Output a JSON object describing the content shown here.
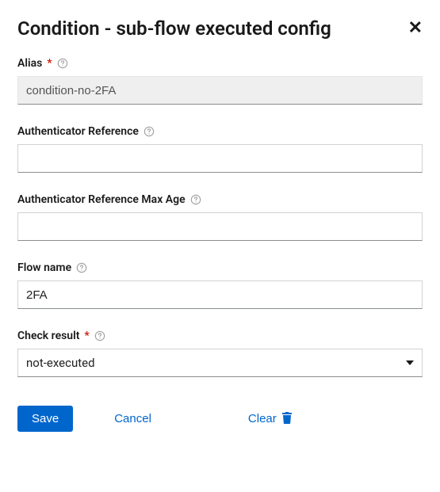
{
  "dialog": {
    "title": "Condition - sub-flow executed config"
  },
  "fields": {
    "alias": {
      "label": "Alias",
      "required": true,
      "value": "condition-no-2FA"
    },
    "authRef": {
      "label": "Authenticator Reference",
      "required": false,
      "value": ""
    },
    "authRefMaxAge": {
      "label": "Authenticator Reference Max Age",
      "required": false,
      "value": ""
    },
    "flowName": {
      "label": "Flow name",
      "required": false,
      "value": "2FA"
    },
    "checkResult": {
      "label": "Check result",
      "required": true,
      "value": "not-executed"
    }
  },
  "buttons": {
    "save": "Save",
    "cancel": "Cancel",
    "clear": "Clear"
  },
  "requiredMark": "*"
}
